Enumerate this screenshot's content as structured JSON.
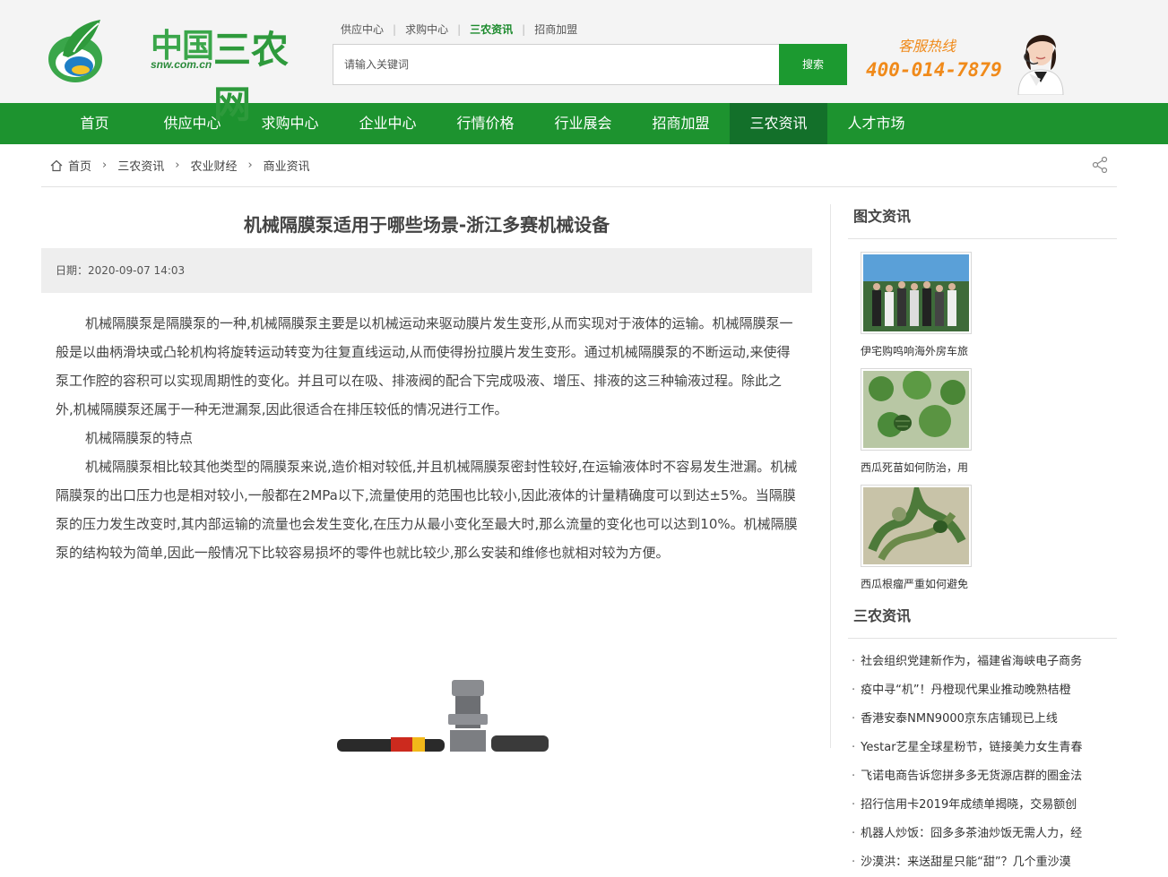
{
  "header": {
    "logo_text": "中国三农网",
    "logo_domain": "snw.com.cn",
    "top_links": [
      "供应中心",
      "求购中心",
      "三农资讯",
      "招商加盟"
    ],
    "top_links_active": "三农资讯",
    "search_placeholder": "请输入关键词",
    "search_button": "搜索",
    "hotline_label": "客服热线",
    "hotline_number": "400-014-7879"
  },
  "nav": {
    "items": [
      "首页",
      "供应中心",
      "求购中心",
      "企业中心",
      "行情价格",
      "行业展会",
      "招商加盟",
      "三农资讯",
      "人才市场"
    ],
    "active": "三农资讯"
  },
  "breadcrumb": [
    "首页",
    "三农资讯",
    "农业财经",
    "商业资讯"
  ],
  "article": {
    "title": "机械隔膜泵适用于哪些场景-浙江多赛机械设备",
    "date": "日期：2020-09-07 14:03",
    "paragraphs": [
      "机械隔膜泵是隔膜泵的一种,机械隔膜泵主要是以机械运动来驱动膜片发生变形,从而实现对于液体的运输。机械隔膜泵一般是以曲柄滑块或凸轮机构将旋转运动转变为往复直线运动,从而使得扮拉膜片发生变形。通过机械隔膜泵的不断运动,来使得泵工作腔的容积可以实现周期性的变化。并且可以在吸、排液阀的配合下完成吸液、增压、排液的这三种输液过程。除此之外,机械隔膜泵还属于一种无泄漏泵,因此很适合在排压较低的情况进行工作。",
      "机械隔膜泵的特点",
      "机械隔膜泵相比较其他类型的隔膜泵来说,造价相对较低,并且机械隔膜泵密封性较好,在运输液体时不容易发生泄漏。机械隔膜泵的出口压力也是相对较小,一般都在2MPa以下,流量使用的范围也比较小,因此液体的计量精确度可以到达±5%。当隔膜泵的压力发生改变时,其内部运输的流量也会发生变化,在压力从最小变化至最大时,那么流量的变化也可以达到10%。机械隔膜泵的结构较为简单,因此一般情况下比较容易损坏的零件也就比较少,那么安装和维修也就相对较为方便。"
    ]
  },
  "sidebar": {
    "pic_news_title": "图文资讯",
    "pic_news": [
      {
        "caption": "伊宅购鸣响海外房车旅"
      },
      {
        "caption": "西瓜死苗如何防治，用"
      },
      {
        "caption": "西瓜根瘤严重如何避免"
      }
    ],
    "news_title": "三农资讯",
    "news": [
      "社会组织党建新作为，福建省海峡电子商务",
      "疫中寻“机”！丹橙现代果业推动晚熟桔橙",
      "香港安泰NMN9000京东店铺现已上线",
      "Yestar艺星全球星粉节，链接美力女生青春",
      "飞诺电商告诉您拼多多无货源店群的圈金法",
      "招行信用卡2019年成绩单揭晓，交易额创",
      "机器人炒饭：囧多多茶油炒饭无需人力，经",
      "沙漠洪：来送甜星只能“甜”？几个重沙漠"
    ]
  },
  "colors": {
    "brand_green": "#1d932f",
    "nav_active": "#13702a",
    "hotline_orange": "#f08a1a"
  }
}
